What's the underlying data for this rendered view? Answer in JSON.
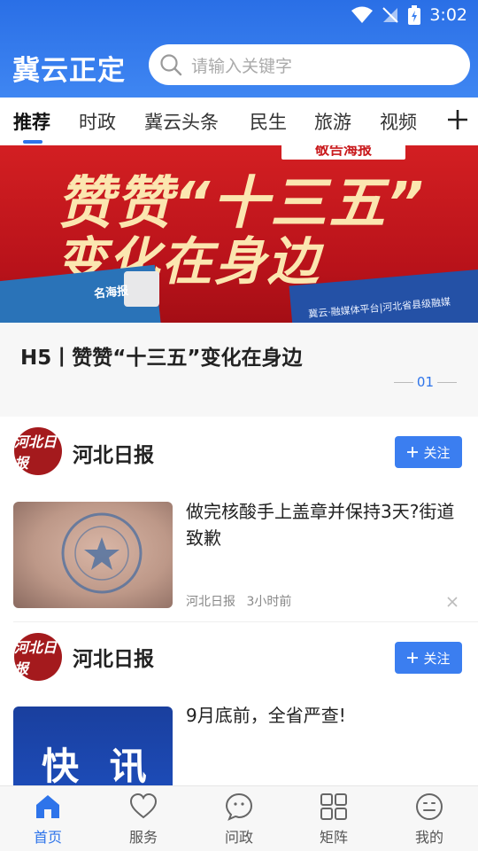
{
  "status_bar": {
    "time": "3:02"
  },
  "header": {
    "brand": "冀云正定",
    "search_placeholder": "请输入关键字"
  },
  "tabs": [
    {
      "label": "推荐",
      "active": true
    },
    {
      "label": "时政"
    },
    {
      "label": "冀云头条"
    },
    {
      "label": "民生"
    },
    {
      "label": "旅游"
    },
    {
      "label": "视频"
    }
  ],
  "banner": {
    "tag": "敬告海报",
    "line1": "赞赞“十三五”",
    "line2": "变化在身边",
    "card_left_text": "名海报",
    "card_right_text": "冀云·融媒体平台|河北省县级融媒"
  },
  "headline": {
    "title": "H5丨赞赞“十三五”变化在身边",
    "page": "01"
  },
  "feed": [
    {
      "source": "河北日报",
      "avatar_text": "河北日报",
      "follow_label": "关注",
      "article": {
        "title": "做完核酸手上盖章并保持3天?街道致歉",
        "meta_source": "河北日报",
        "meta_time": "3小时前"
      }
    },
    {
      "source": "河北日报",
      "avatar_text": "河北日报",
      "follow_label": "关注",
      "article": {
        "title": "9月底前，全省严查!",
        "thumb_text": "快 讯"
      }
    }
  ],
  "bottom_nav": [
    {
      "label": "首页",
      "icon": "home-icon",
      "active": true
    },
    {
      "label": "服务",
      "icon": "heart-icon"
    },
    {
      "label": "问政",
      "icon": "chat-icon"
    },
    {
      "label": "矩阵",
      "icon": "grid-icon"
    },
    {
      "label": "我的",
      "icon": "profile-icon"
    }
  ],
  "colors": {
    "primary": "#2e74ea",
    "header": "#3a80f0",
    "banner_red": "#c91a1d"
  }
}
